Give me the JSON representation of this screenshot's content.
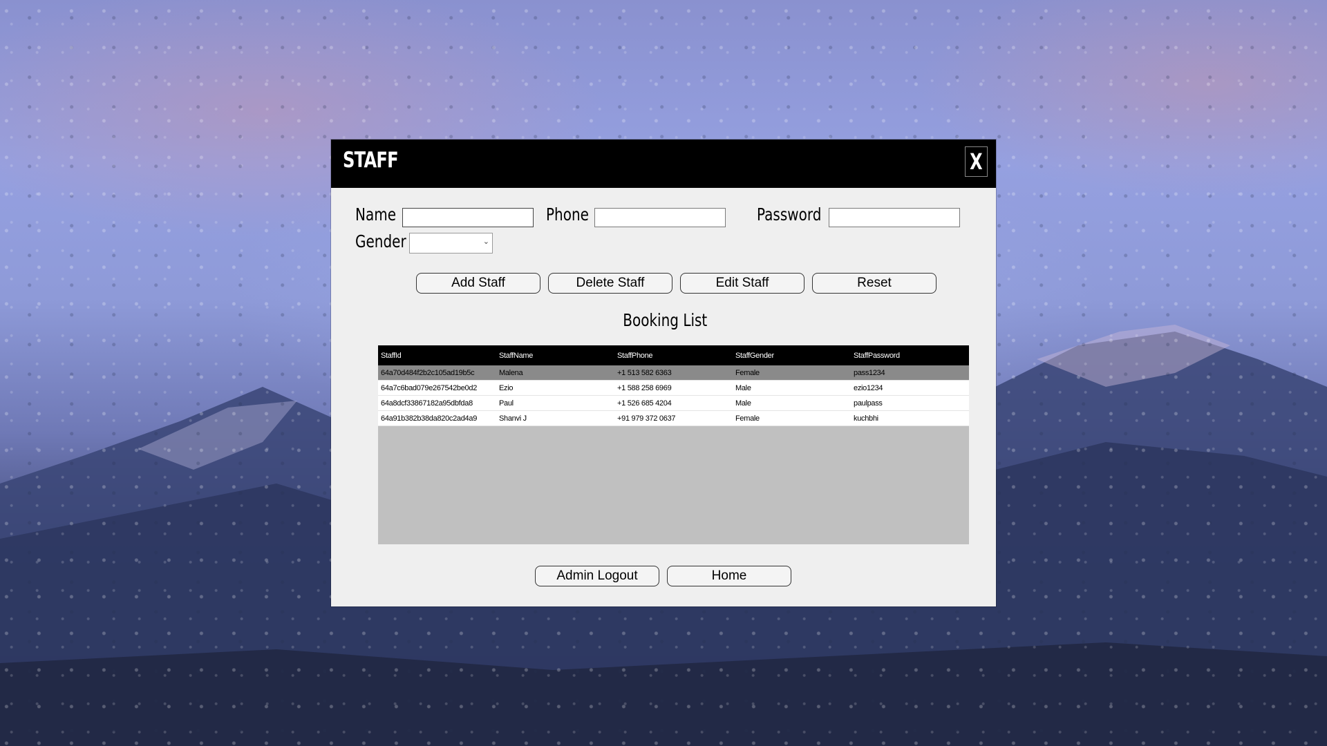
{
  "window": {
    "title": "STAFF",
    "close_label": "X"
  },
  "form": {
    "name_label": "Name",
    "name_value": "",
    "phone_label": "Phone",
    "phone_value": "",
    "password_label": "Password",
    "password_value": "",
    "gender_label": "Gender",
    "gender_value": ""
  },
  "actions": {
    "add_label": "Add Staff",
    "delete_label": "Delete Staff",
    "edit_label": "Edit Staff",
    "reset_label": "Reset"
  },
  "list": {
    "title": "Booking List",
    "columns": [
      "StaffId",
      "StaffName",
      "StaffPhone",
      "StaffGender",
      "StaffPassword"
    ],
    "rows": [
      [
        "64a70d484f2b2c105ad19b5c",
        "Malena",
        "+1 513 582 6363",
        "Female",
        "pass1234"
      ],
      [
        "64a7c6bad079e267542be0d2",
        "Ezio",
        "+1 588 258 6969",
        "Male",
        "ezio1234"
      ],
      [
        "64a8dcf33867182a95dbfda8",
        "Paul",
        "+1 526 685 4204",
        "Male",
        "paulpass"
      ],
      [
        "64a91b382b38da820c2ad4a9",
        "Shanvi J",
        "+91 979 372 0637",
        "Female",
        "kuchbhi"
      ]
    ],
    "selected_row": 0
  },
  "footer": {
    "logout_label": "Admin Logout",
    "home_label": "Home"
  },
  "colors": {
    "titlebar": "#000000",
    "panel": "#efefef",
    "selected_row": "#8a8a8a",
    "grid_empty": "#c0c0c0"
  }
}
